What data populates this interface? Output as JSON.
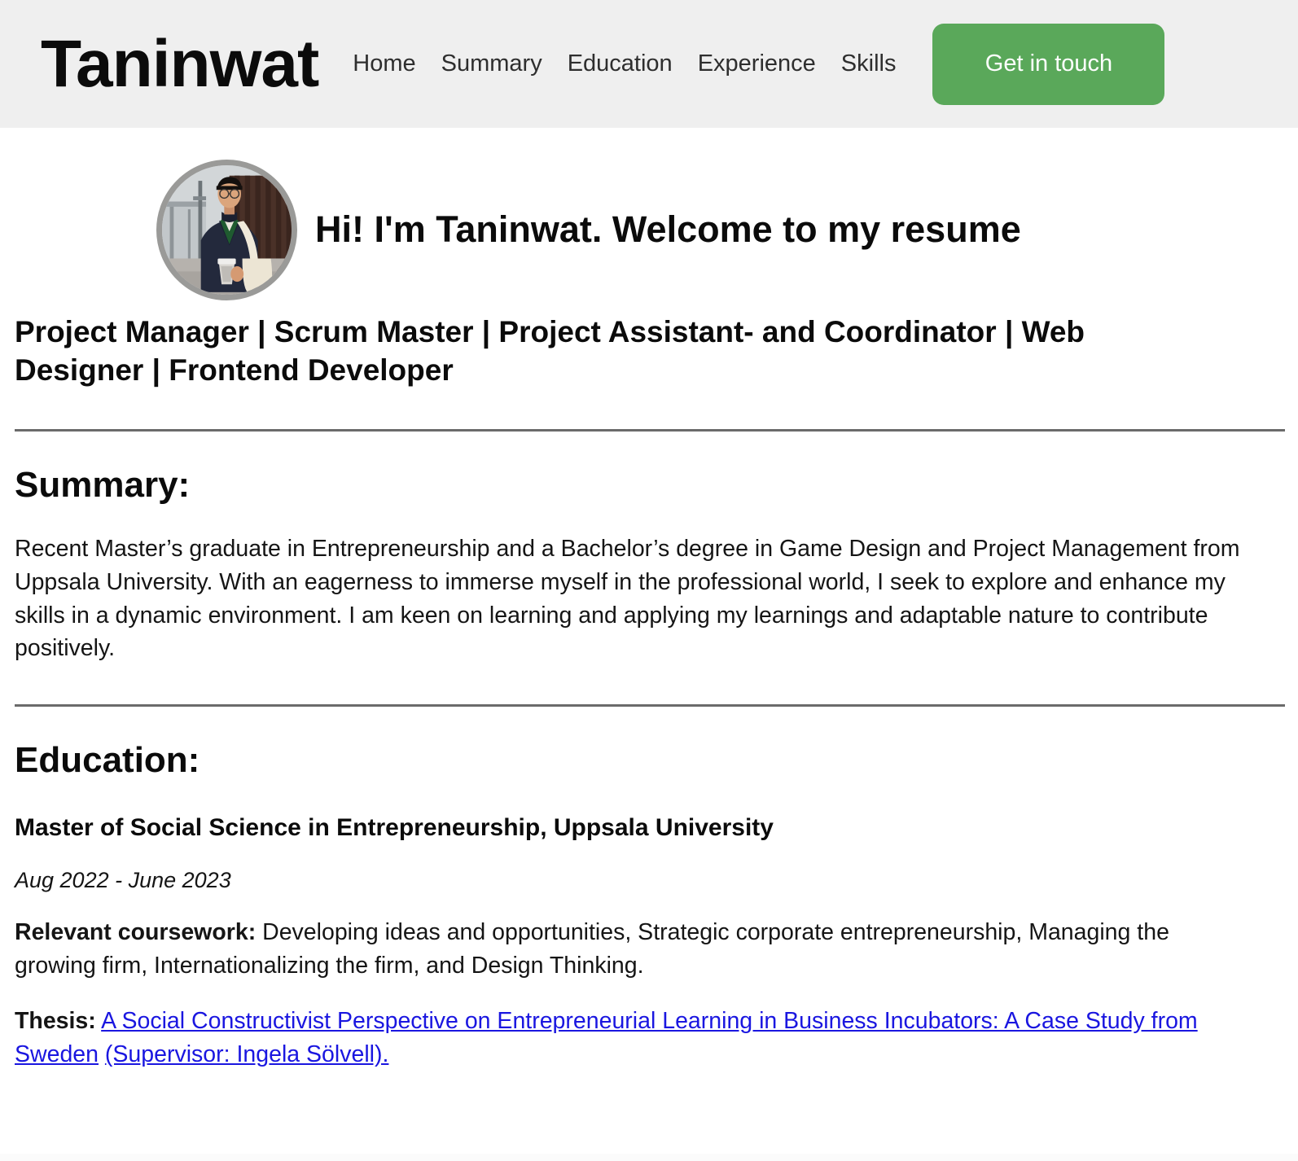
{
  "header": {
    "brand": "Taninwat",
    "nav_items": [
      {
        "label": "Home"
      },
      {
        "label": "Summary"
      },
      {
        "label": "Education"
      },
      {
        "label": "Experience"
      },
      {
        "label": "Skills"
      }
    ],
    "cta_label": "Get in touch",
    "background_color": "#efefef",
    "cta_color": "#5aa85a"
  },
  "hero": {
    "avatar_alt": "profile-photo",
    "title": "Hi! I'm Taninwat. Welcome to my resume",
    "role_line": "Project Manager | Scrum Master | Project Assistant- and Coordinator | Web Designer | Frontend Developer"
  },
  "summary": {
    "heading": "Summary:",
    "body": "Recent Master’s graduate in Entrepreneurship and a Bachelor’s degree in Game Design and Project Management from Uppsala University. With an eagerness to immerse myself in the professional world, I seek to explore and enhance my skills in a dynamic environment. I am keen on learning and applying my learnings and adaptable nature to contribute positively."
  },
  "education": {
    "heading": "Education:",
    "entries": [
      {
        "degree": "Master of Social Science in Entrepreneurship, Uppsala University",
        "dates": "Aug 2022 - June 2023",
        "coursework_label": "Relevant coursework:",
        "coursework_text": " Developing ideas and opportunities, Strategic corporate entrepreneurship, Managing the growing firm, Internationalizing the firm, and Design Thinking.",
        "thesis_label": "Thesis:",
        "thesis_link_text": "A Social Constructivist Perspective on Entrepreneurial Learning in Business Incubators: A Case Study from Sweden",
        "thesis_supervisor_text": "(Supervisor: Ingela Sölvell)."
      }
    ]
  },
  "theme": {
    "link_color": "#1a16e0",
    "rule_color": "#6b6b6b",
    "text_color": "#151515"
  }
}
